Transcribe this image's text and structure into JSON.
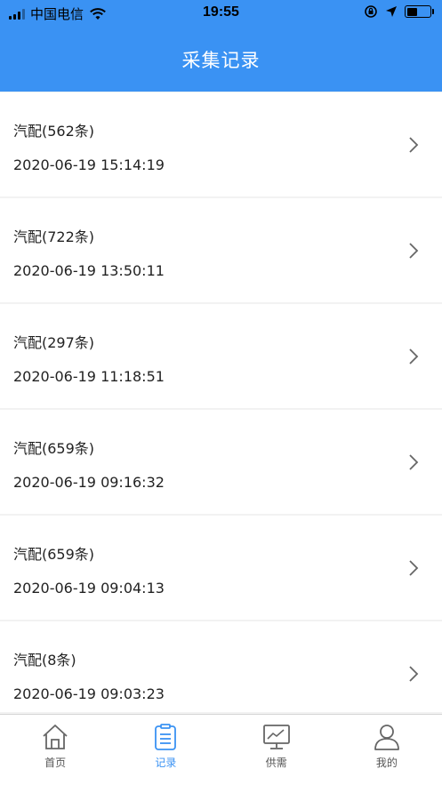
{
  "status_bar": {
    "carrier": "中国电信",
    "time": "19:55"
  },
  "header": {
    "title": "采集记录"
  },
  "records": [
    {
      "title": "汽配(562条)",
      "time": "2020-06-19 15:14:19"
    },
    {
      "title": "汽配(722条)",
      "time": "2020-06-19 13:50:11"
    },
    {
      "title": "汽配(297条)",
      "time": "2020-06-19 11:18:51"
    },
    {
      "title": "汽配(659条)",
      "time": "2020-06-19 09:16:32"
    },
    {
      "title": "汽配(659条)",
      "time": "2020-06-19 09:04:13"
    },
    {
      "title": "汽配(8条)",
      "time": "2020-06-19 09:03:23"
    }
  ],
  "tabbar": {
    "tabs": [
      {
        "label": "首页",
        "icon": "home-icon"
      },
      {
        "label": "记录",
        "icon": "clipboard-icon",
        "active": true
      },
      {
        "label": "供需",
        "icon": "chart-monitor-icon"
      },
      {
        "label": "我的",
        "icon": "user-icon"
      }
    ]
  },
  "colors": {
    "accent": "#3a92f3",
    "background": "#f2f2f2",
    "icon_gray": "#666666"
  }
}
